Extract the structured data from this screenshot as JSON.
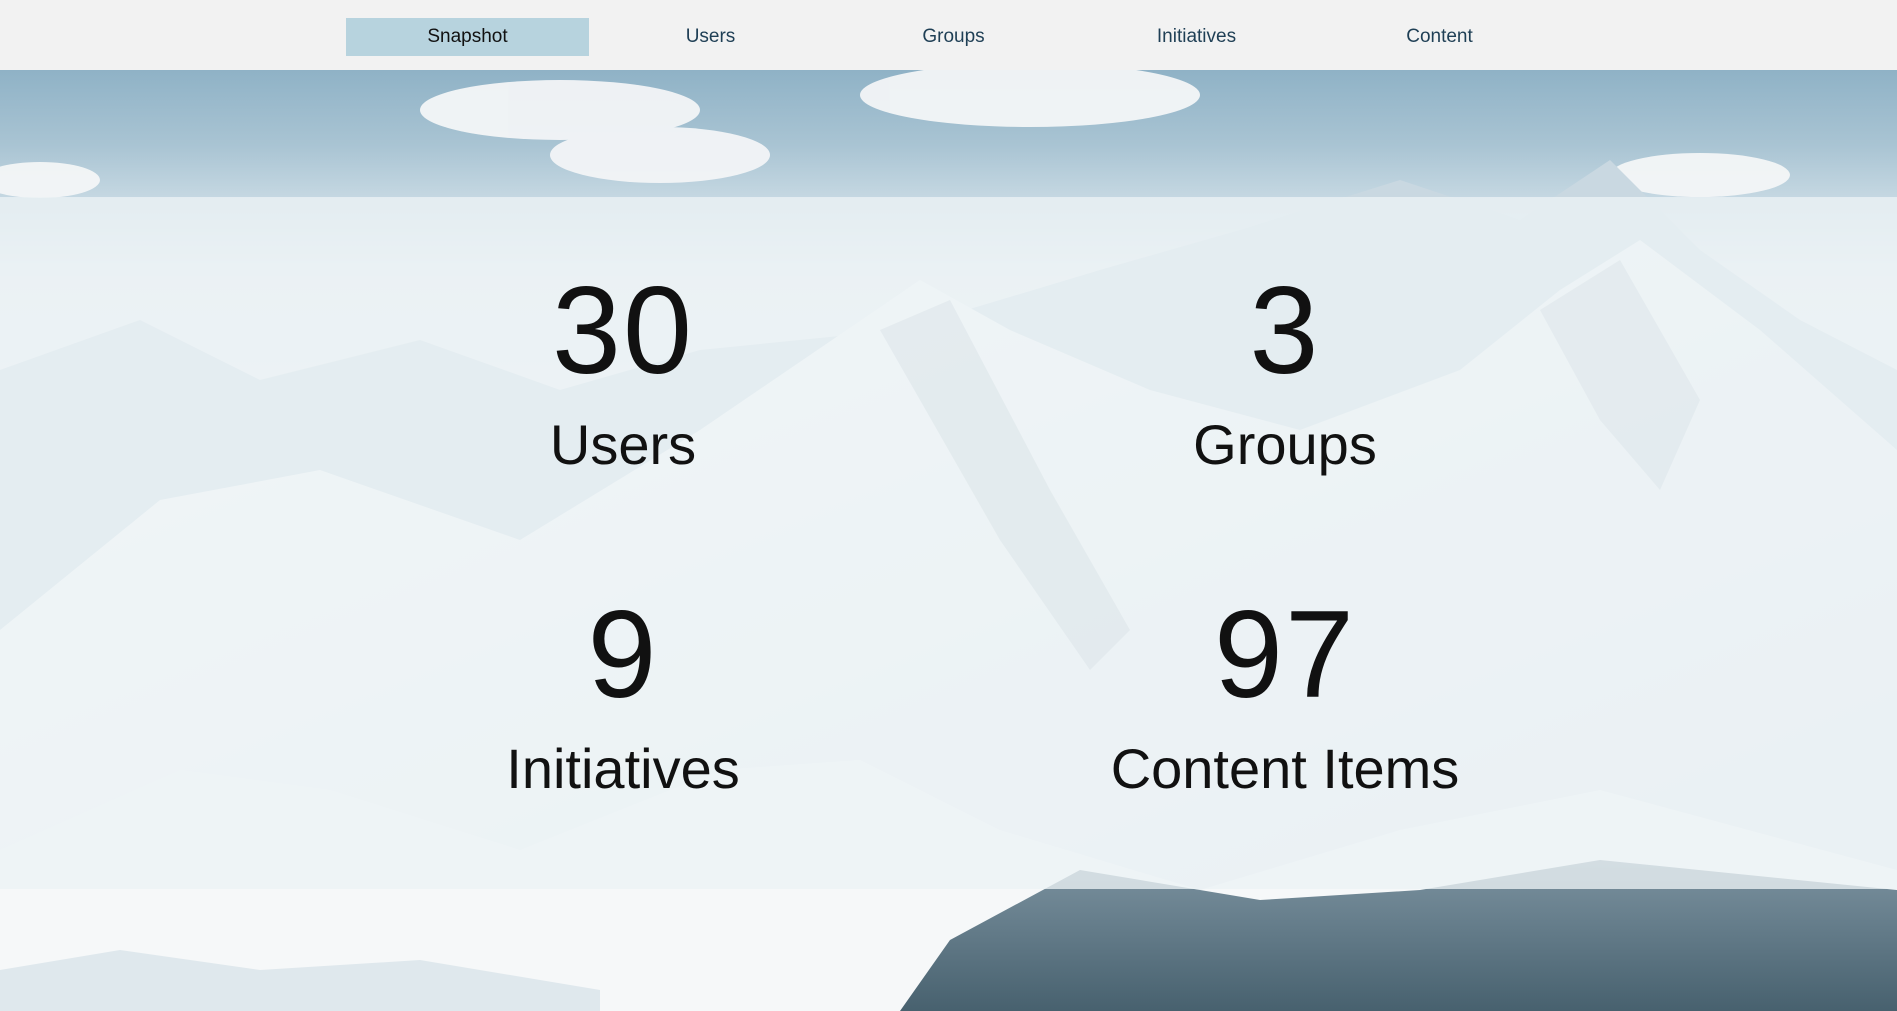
{
  "nav": {
    "tabs": [
      {
        "label": "Snapshot",
        "active": true
      },
      {
        "label": "Users",
        "active": false
      },
      {
        "label": "Groups",
        "active": false
      },
      {
        "label": "Initiatives",
        "active": false
      },
      {
        "label": "Content",
        "active": false
      }
    ]
  },
  "stats": {
    "users": {
      "value": "30",
      "label": "Users"
    },
    "groups": {
      "value": "3",
      "label": "Groups"
    },
    "initiatives": {
      "value": "9",
      "label": "Initiatives"
    },
    "content": {
      "value": "97",
      "label": "Content Items"
    }
  },
  "colors": {
    "nav_bg": "#f2f2f2",
    "active_tab_bg": "#b7d3de",
    "tab_text": "#1f3f55",
    "stat_text": "#111111"
  }
}
